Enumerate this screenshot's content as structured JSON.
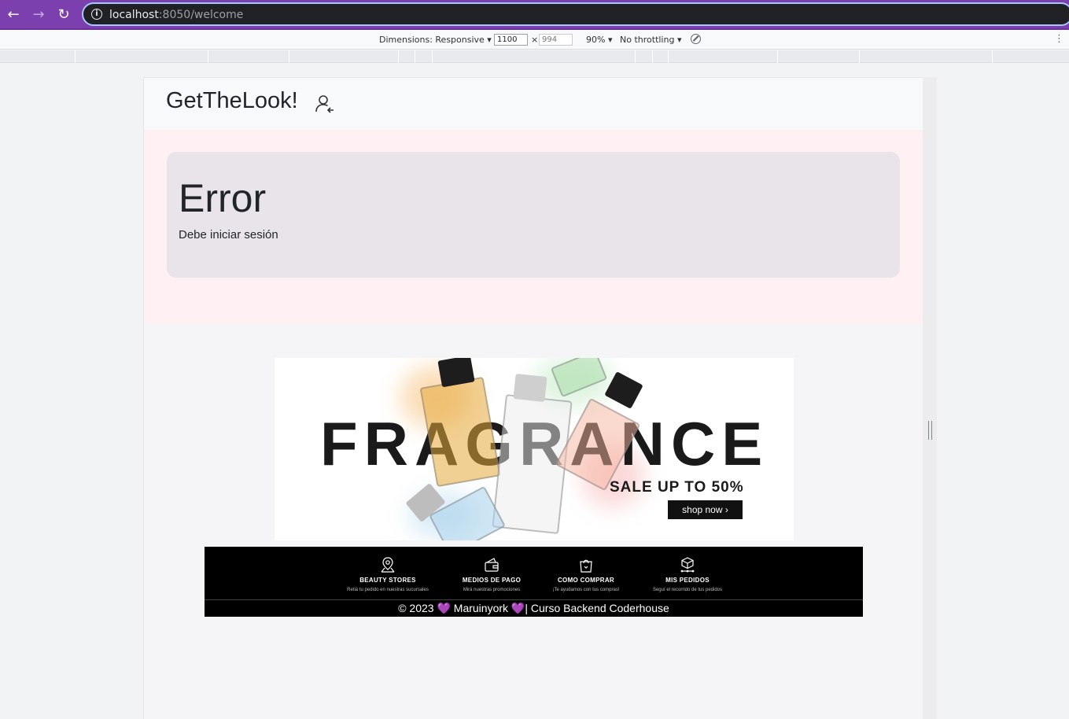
{
  "browser": {
    "url_host": "localhost",
    "url_rest": ":8050/welcome",
    "back_glyph": "←",
    "forward_glyph": "→",
    "reload_glyph": "↻",
    "info_glyph": "i"
  },
  "devtools": {
    "dimensions_label": "Dimensions: Responsive ▾",
    "width_value": "1100",
    "height_placeholder": "994",
    "times": "×",
    "zoom_label": "90% ▾",
    "throttle_label": "No throttling ▾",
    "kebab": "⋮"
  },
  "site": {
    "brand": "GetTheLook!",
    "error_title": "Error",
    "error_message": "Debe iniciar sesión"
  },
  "banner": {
    "headline": "FRAGRANCE",
    "sale": "SALE UP TO 50%",
    "cta": "shop now ›"
  },
  "footer": {
    "features": [
      {
        "title": "BEAUTY STORES",
        "subtitle": "Retiá tu pedido en nuestras sucursales"
      },
      {
        "title": "MEDIOS DE PAGO",
        "subtitle": "Mirá nuestras promociones"
      },
      {
        "title": "COMO COMPRAR",
        "subtitle": "¡Te ayudamos con tus compras!"
      },
      {
        "title": "MIS PEDIDOS",
        "subtitle": "Seguí el recorrido de tus pedidos"
      }
    ],
    "copy_prefix": "© 2023",
    "heart": "💜",
    "copy_author": "Maruinyork",
    "copy_suffix": "| Curso Backend Coderhouse"
  }
}
